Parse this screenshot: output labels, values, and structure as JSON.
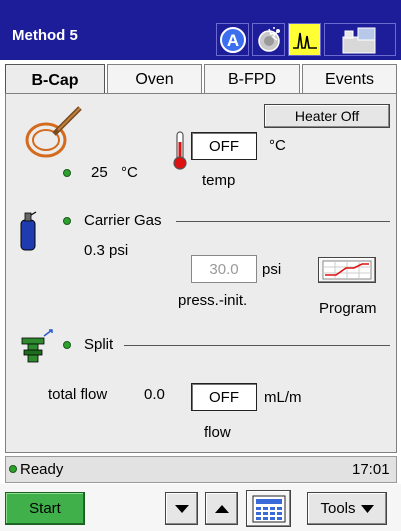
{
  "window": {
    "title": "Method 5",
    "toolbar_icons": [
      "a-circle-icon",
      "settings-sparkle-icon",
      "chromatogram-icon",
      "instrument-icon"
    ]
  },
  "tabs": [
    {
      "label": "B-Cap",
      "active": true
    },
    {
      "label": "Oven",
      "active": false
    },
    {
      "label": "B-FPD",
      "active": false
    },
    {
      "label": "Events",
      "active": false
    }
  ],
  "heater": {
    "button_label": "Heater Off",
    "current_temp": "25",
    "current_unit": "°C",
    "setpoint": "OFF",
    "setpoint_unit": "°C",
    "setpoint_label": "temp"
  },
  "carrier_gas": {
    "label": "Carrier Gas",
    "current_pressure": "0.3 psi",
    "pressure_setpoint": "30.0",
    "pressure_unit": "psi",
    "pressure_label": "press.-init.",
    "program_label": "Program"
  },
  "split": {
    "label": "Split",
    "total_flow_label": "total flow",
    "total_flow_value": "0.0",
    "flow_setpoint": "OFF",
    "flow_unit": "mL/m",
    "flow_label": "flow"
  },
  "status": {
    "text": "Ready",
    "time": "17:01"
  },
  "bottom_bar": {
    "start_label": "Start",
    "tools_label": "Tools"
  },
  "colors": {
    "titlebar": "#1d1d9a",
    "status_led": "#2ea02e",
    "start_button": "#3fb04a"
  }
}
